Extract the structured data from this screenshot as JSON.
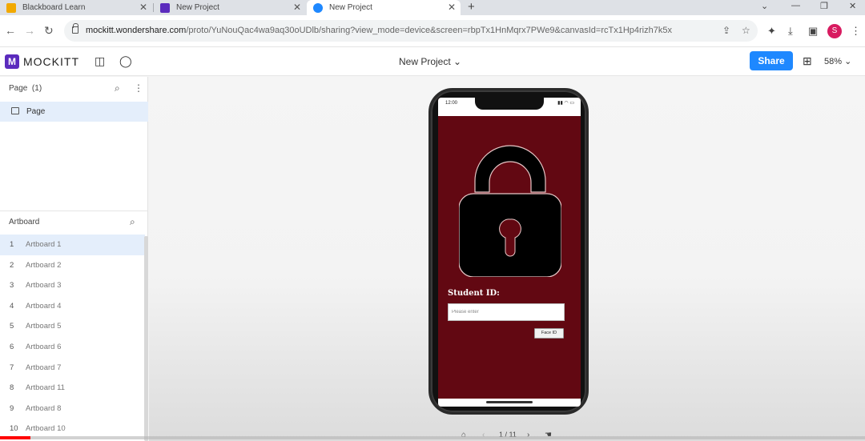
{
  "browser": {
    "tabs": [
      {
        "label": "Blackboard Learn",
        "favicon_color": "#f2a900"
      },
      {
        "label": "New Project",
        "favicon_color": "#5b2bbd"
      },
      {
        "label": "New Project",
        "favicon_color": "#1e88ff"
      }
    ],
    "new_tab_symbol": "+",
    "url_host": "mockitt.wondershare.com",
    "url_path": "/proto/YuNouQac4wa9aq30oUDlb/sharing?view_mode=device&screen=rbpTx1HnMqrx7PWe9&canvasId=rcTx1Hp4rizh7k5x",
    "profile_initial": "S"
  },
  "app": {
    "brand": "MOCKITT",
    "logo_letter": "M",
    "project_title": "New Project",
    "share_label": "Share",
    "zoom": "58%"
  },
  "left_panel": {
    "page_header": "Page",
    "page_count": "(1)",
    "page_item": "Page",
    "artboard_header": "Artboard",
    "artboards": [
      {
        "num": "1",
        "name": "Artboard 1"
      },
      {
        "num": "2",
        "name": "Artboard 2"
      },
      {
        "num": "3",
        "name": "Artboard 3"
      },
      {
        "num": "4",
        "name": "Artboard 4"
      },
      {
        "num": "5",
        "name": "Artboard 5"
      },
      {
        "num": "6",
        "name": "Artboard 6"
      },
      {
        "num": "7",
        "name": "Artboard 7"
      },
      {
        "num": "8",
        "name": "Artboard 11"
      },
      {
        "num": "9",
        "name": "Artboard 8"
      },
      {
        "num": "10",
        "name": "Artboard 10"
      }
    ]
  },
  "prototype": {
    "status_time": "12:00",
    "background_color": "#620812",
    "student_id_label": "Student ID:",
    "input_placeholder": "Please enter",
    "face_button_label": "Face ID"
  },
  "pager": {
    "text": "1 / 11"
  },
  "video": {
    "progress": 0.035
  }
}
